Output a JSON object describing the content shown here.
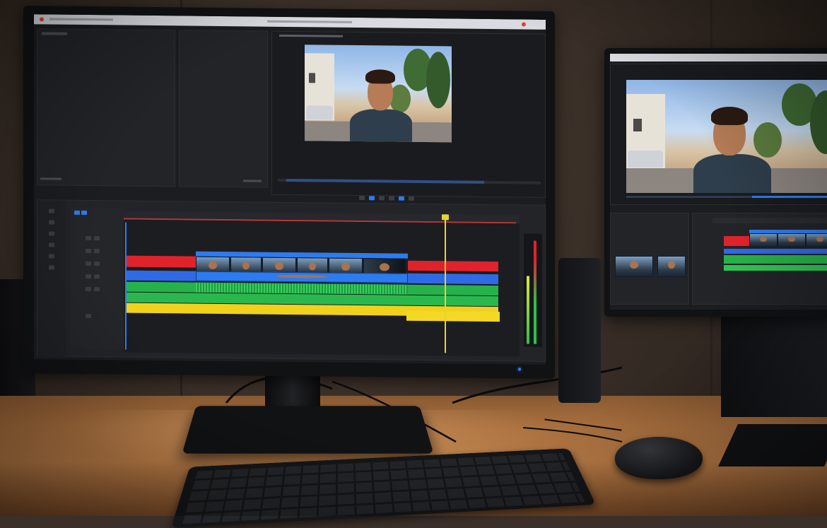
{
  "scene": {
    "description_free": true
  },
  "colors": {
    "track_red": "#e0232b",
    "track_blue": "#2f6ae6",
    "track_green": "#26b24a",
    "track_yellow": "#f0d21c",
    "clip_header": "#2d7bf0",
    "playhead": "#e7d23a",
    "in_marker": "#d83a3a",
    "wood": "#b97c46"
  },
  "icons": [
    "record-dot-icon",
    "play-icon",
    "stop-icon",
    "step-icon",
    "lock-icon",
    "eye-icon",
    "speaker-icon"
  ]
}
